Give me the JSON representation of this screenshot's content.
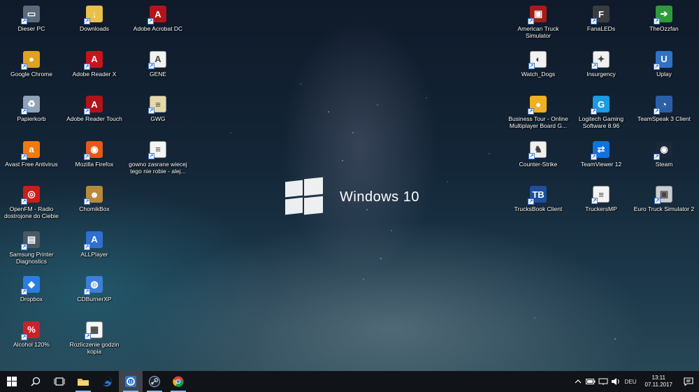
{
  "desktop": {
    "wallpaper_text": "Windows 10",
    "left_icons": [
      {
        "label": "Dieser PC",
        "icon": "computer-icon",
        "color": "#5a6a7a",
        "glyph": "▭"
      },
      {
        "label": "Downloads",
        "icon": "downloads-folder-icon",
        "color": "#e8c04a",
        "glyph": "↓"
      },
      {
        "label": "Adobe Acrobat DC",
        "icon": "acrobat-icon",
        "color": "#b3141b",
        "glyph": "A"
      },
      {
        "label": "Google Chrome",
        "icon": "chrome-icon",
        "color": "#e0a020",
        "glyph": "●"
      },
      {
        "label": "Adobe Reader X",
        "icon": "adobe-reader-icon",
        "color": "#c8141c",
        "glyph": "A"
      },
      {
        "label": "GENE",
        "icon": "pdf-file-icon",
        "color": "#f2f2f2",
        "glyph": "A"
      },
      {
        "label": "Papierkorb",
        "icon": "recycle-bin-icon",
        "color": "#8fa3b5",
        "glyph": "♻"
      },
      {
        "label": "Adobe Reader Touch",
        "icon": "adobe-reader-touch-icon",
        "color": "#b01419",
        "glyph": "A"
      },
      {
        "label": "GWG",
        "icon": "document-file-icon",
        "color": "#e6d9a8",
        "glyph": "≡"
      },
      {
        "label": "Avast Free Antivirus",
        "icon": "avast-icon",
        "color": "#f07a12",
        "glyph": "a"
      },
      {
        "label": "Mozilla Firefox",
        "icon": "firefox-icon",
        "color": "#e5581b",
        "glyph": "◉"
      },
      {
        "label": "gowno zasrane wiecej tego nie robie - alej...",
        "icon": "text-file-icon",
        "color": "#f4f4f4",
        "glyph": "≡"
      },
      {
        "label": "OpenFM - Radio dostrojone do Ciebie",
        "icon": "openfm-icon",
        "color": "#d11a1a",
        "glyph": "◎"
      },
      {
        "label": "ChomikBox",
        "icon": "chomikbox-icon",
        "color": "#b98a3a",
        "glyph": "☻"
      },
      {
        "label": "Samsung Printer Diagnostics",
        "icon": "printer-icon",
        "color": "#4a5866",
        "glyph": "▤"
      },
      {
        "label": "ALLPlayer",
        "icon": "allplayer-icon",
        "color": "#2f6fd0",
        "glyph": "A"
      },
      {
        "label": "Dropbox",
        "icon": "dropbox-icon",
        "color": "#2a7de1",
        "glyph": "◆"
      },
      {
        "label": "CDBurnerXP",
        "icon": "cdburnerxp-icon",
        "color": "#3c7fd8",
        "glyph": "◍"
      },
      {
        "label": "Alcohol 120%",
        "icon": "alcohol-icon",
        "color": "#c8232b",
        "glyph": "%"
      },
      {
        "label": "Rozliczenie godzin kopia",
        "icon": "spreadsheet-file-icon",
        "color": "#f6f6f6",
        "glyph": "▦"
      }
    ],
    "right_icons": [
      {
        "label": "American Truck Simulator",
        "icon": "ats-icon",
        "color": "#a51c1c",
        "glyph": "▣"
      },
      {
        "label": "FanaLEDs",
        "icon": "fanaleds-icon",
        "color": "#3a3d40",
        "glyph": "F"
      },
      {
        "label": "TheOzzfan",
        "icon": "ozzfan-icon",
        "color": "#2f9a3a",
        "glyph": "➔"
      },
      {
        "label": "Watch_Dogs",
        "icon": "watchdogs-icon",
        "color": "#f2f2f2",
        "glyph": "◐"
      },
      {
        "label": "Insurgency",
        "icon": "insurgency-icon",
        "color": "#f0f0f0",
        "glyph": "✦"
      },
      {
        "label": "Uplay",
        "icon": "uplay-icon",
        "color": "#2f72c8",
        "glyph": "U"
      },
      {
        "label": "Business Tour - Online Multiplayer Board G...",
        "icon": "business-tour-icon",
        "color": "#f0b020",
        "glyph": "●"
      },
      {
        "label": "Logitech Gaming Software 8.96",
        "icon": "logitech-icon",
        "color": "#1b9be0",
        "glyph": "G"
      },
      {
        "label": "TeamSpeak 3 Client",
        "icon": "teamspeak-icon",
        "color": "#2a5fa8",
        "glyph": "◔"
      },
      {
        "label": "Counter-Strike",
        "icon": "counter-strike-icon",
        "color": "#f0f0f0",
        "glyph": "♞"
      },
      {
        "label": "TeamViewer 12",
        "icon": "teamviewer-icon",
        "color": "#0e72e0",
        "glyph": "⇄"
      },
      {
        "label": "Steam",
        "icon": "steam-icon",
        "color": "#1b2838",
        "glyph": "◉"
      },
      {
        "label": "TrucksBook Client",
        "icon": "trucksbook-icon",
        "color": "#1d4f9c",
        "glyph": "TB"
      },
      {
        "label": "TruckersMP",
        "icon": "truckersmp-file-icon",
        "color": "#f4f4f4",
        "glyph": "≡"
      },
      {
        "label": "Euro Truck Simulator 2",
        "icon": "ets2-icon",
        "color": "#c9ccd0",
        "glyph": "▣"
      }
    ]
  },
  "taskbar": {
    "apps": [
      {
        "name": "start-button",
        "icon": "windows-start-icon"
      },
      {
        "name": "search-button",
        "icon": "search-icon"
      },
      {
        "name": "task-view-button",
        "icon": "task-view-icon"
      },
      {
        "name": "taskbar-file-explorer",
        "icon": "folder-icon",
        "color": "#e8c04a"
      },
      {
        "name": "taskbar-edge",
        "icon": "edge-icon",
        "color": "#1e78d6"
      },
      {
        "name": "taskbar-uplay",
        "icon": "uplay-icon",
        "color": "#2f72c8"
      },
      {
        "name": "taskbar-steam",
        "icon": "steam-icon",
        "color": "#9db5cf"
      },
      {
        "name": "taskbar-chrome",
        "icon": "chrome-icon",
        "color": "#e0a020"
      }
    ],
    "tray": {
      "language": "DEU",
      "time": "13:11",
      "date": "07.11.2017"
    }
  }
}
